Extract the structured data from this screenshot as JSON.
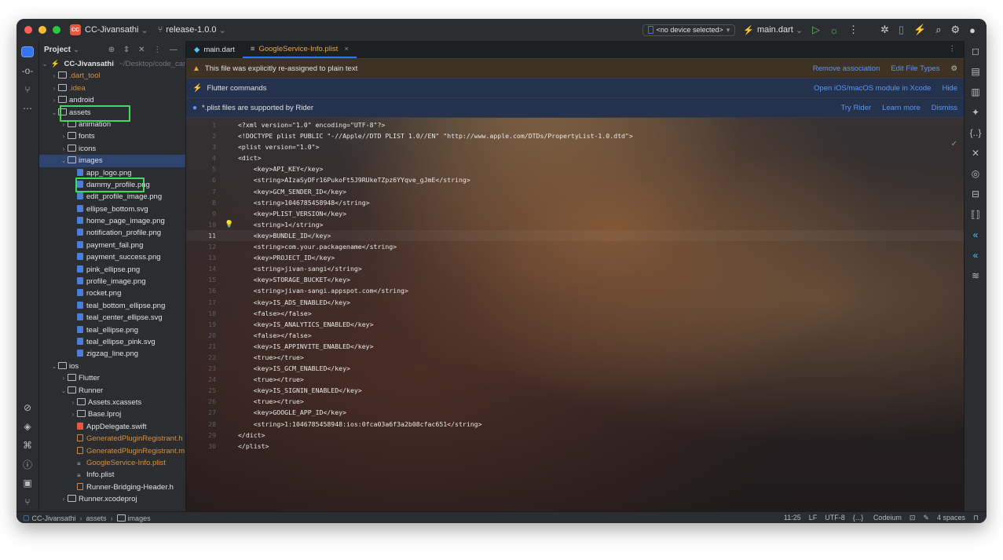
{
  "titlebar": {
    "project_badge": "CC",
    "project": "CC-Jivansathi",
    "branch": "release-1.0.0",
    "device": "<no device selected>",
    "run_config": "main.dart"
  },
  "project_panel": {
    "title": "Project",
    "root_name": "CC-Jivansathi",
    "root_path": "~/Desktop/code_canyo",
    "tree": [
      {
        "label": ".dart_tool",
        "depth": 1,
        "kind": "folder",
        "chev": "›",
        "cls": "excluded"
      },
      {
        "label": ".idea",
        "depth": 1,
        "kind": "folder",
        "chev": "›",
        "cls": "excluded"
      },
      {
        "label": "android",
        "depth": 1,
        "kind": "folder",
        "chev": "›",
        "cls": ""
      },
      {
        "label": "assets",
        "depth": 1,
        "kind": "folder",
        "chev": "⌄",
        "cls": ""
      },
      {
        "label": "animation",
        "depth": 2,
        "kind": "folder",
        "chev": "›",
        "cls": ""
      },
      {
        "label": "fonts",
        "depth": 2,
        "kind": "folder",
        "chev": "›",
        "cls": ""
      },
      {
        "label": "icons",
        "depth": 2,
        "kind": "folder",
        "chev": "›",
        "cls": ""
      },
      {
        "label": "images",
        "depth": 2,
        "kind": "folder",
        "chev": "⌄",
        "cls": "selected"
      },
      {
        "label": "app_logo.png",
        "depth": 3,
        "kind": "img",
        "chev": "",
        "cls": ""
      },
      {
        "label": "dammy_profile.png",
        "depth": 3,
        "kind": "img",
        "chev": "",
        "cls": ""
      },
      {
        "label": "edit_profile_image.png",
        "depth": 3,
        "kind": "img",
        "chev": "",
        "cls": ""
      },
      {
        "label": "ellipse_bottom.svg",
        "depth": 3,
        "kind": "img",
        "chev": "",
        "cls": ""
      },
      {
        "label": "home_page_image.png",
        "depth": 3,
        "kind": "img",
        "chev": "",
        "cls": ""
      },
      {
        "label": "notification_profile.png",
        "depth": 3,
        "kind": "img",
        "chev": "",
        "cls": ""
      },
      {
        "label": "payment_fail.png",
        "depth": 3,
        "kind": "img",
        "chev": "",
        "cls": ""
      },
      {
        "label": "payment_success.png",
        "depth": 3,
        "kind": "img",
        "chev": "",
        "cls": ""
      },
      {
        "label": "pink_ellipse.png",
        "depth": 3,
        "kind": "img",
        "chev": "",
        "cls": ""
      },
      {
        "label": "profile_image.png",
        "depth": 3,
        "kind": "img",
        "chev": "",
        "cls": ""
      },
      {
        "label": "rocket.png",
        "depth": 3,
        "kind": "img",
        "chev": "",
        "cls": ""
      },
      {
        "label": "teal_bottom_ellipse.png",
        "depth": 3,
        "kind": "img",
        "chev": "",
        "cls": ""
      },
      {
        "label": "teal_center_ellipse.svg",
        "depth": 3,
        "kind": "img",
        "chev": "",
        "cls": ""
      },
      {
        "label": "teal_ellipse.png",
        "depth": 3,
        "kind": "img",
        "chev": "",
        "cls": ""
      },
      {
        "label": "teal_ellipse_pink.svg",
        "depth": 3,
        "kind": "img",
        "chev": "",
        "cls": ""
      },
      {
        "label": "zigzag_line.png",
        "depth": 3,
        "kind": "img",
        "chev": "",
        "cls": ""
      },
      {
        "label": "ios",
        "depth": 1,
        "kind": "folder",
        "chev": "⌄",
        "cls": ""
      },
      {
        "label": "Flutter",
        "depth": 2,
        "kind": "folder",
        "chev": "›",
        "cls": ""
      },
      {
        "label": "Runner",
        "depth": 2,
        "kind": "folder",
        "chev": "⌄",
        "cls": ""
      },
      {
        "label": "Assets.xcassets",
        "depth": 3,
        "kind": "folder",
        "chev": "›",
        "cls": ""
      },
      {
        "label": "Base.lproj",
        "depth": 3,
        "kind": "folder",
        "chev": "›",
        "cls": ""
      },
      {
        "label": "AppDelegate.swift",
        "depth": 3,
        "kind": "swift",
        "chev": "",
        "cls": ""
      },
      {
        "label": "GeneratedPluginRegistrant.h",
        "depth": 3,
        "kind": "h",
        "chev": "",
        "cls": "excluded"
      },
      {
        "label": "GeneratedPluginRegistrant.m",
        "depth": 3,
        "kind": "h",
        "chev": "",
        "cls": "excluded"
      },
      {
        "label": "GoogleService-Info.plist",
        "depth": 3,
        "kind": "txt",
        "chev": "",
        "cls": "excluded"
      },
      {
        "label": "Info.plist",
        "depth": 3,
        "kind": "txt",
        "chev": "",
        "cls": ""
      },
      {
        "label": "Runner-Bridging-Header.h",
        "depth": 3,
        "kind": "h",
        "chev": "",
        "cls": ""
      },
      {
        "label": "Runner.xcodeproj",
        "depth": 2,
        "kind": "folder",
        "chev": "›",
        "cls": ""
      }
    ]
  },
  "tabs": [
    {
      "label": "main.dart",
      "active": false
    },
    {
      "label": "GoogleService-Info.plist",
      "active": true
    }
  ],
  "banners": {
    "warning": {
      "text": "This file was explicitly re-assigned to plain text",
      "actions": [
        "Remove association",
        "Edit File Types"
      ]
    },
    "flutter": {
      "text": "Flutter commands",
      "actions": [
        "Open iOS/macOS module in Xcode",
        "Hide"
      ]
    },
    "info": {
      "text": "*.plist files are supported by Rider",
      "actions": [
        "Try Rider",
        "Learn more",
        "Dismiss"
      ]
    }
  },
  "code": {
    "current_line": 11,
    "bulb_line": 10,
    "lines": [
      "<?xml version=\"1.0\" encoding=\"UTF-8\"?>",
      "<!DOCTYPE plist PUBLIC \"-//Apple//DTD PLIST 1.0//EN\" \"http://www.apple.com/DTDs/PropertyList-1.0.dtd\">",
      "<plist version=\"1.0\">",
      "<dict>",
      "    <key>API_KEY</key>",
      "    <string>AIzaSyDFr16PukoFt5J9RUkeTZpz6YYqve_gJmE</string>",
      "    <key>GCM_SENDER_ID</key>",
      "    <string>1046785458948</string>",
      "    <key>PLIST_VERSION</key>",
      "    <string>1</string>",
      "    <key>BUNDLE_ID</key>",
      "    <string>com.your.packagename</string>",
      "    <key>PROJECT_ID</key>",
      "    <string>jivan-sangi</string>",
      "    <key>STORAGE_BUCKET</key>",
      "    <string>jivan-sangi.appspot.com</string>",
      "    <key>IS_ADS_ENABLED</key>",
      "    <false></false>",
      "    <key>IS_ANALYTICS_ENABLED</key>",
      "    <false></false>",
      "    <key>IS_APPINVITE_ENABLED</key>",
      "    <true></true>",
      "    <key>IS_GCM_ENABLED</key>",
      "    <true></true>",
      "    <key>IS_SIGNIN_ENABLED</key>",
      "    <true></true>",
      "    <key>GOOGLE_APP_ID</key>",
      "    <string>1:1046785458948:ios:0fca03a6f3a2b08cfac651</string>",
      "</dict>",
      "</plist>"
    ]
  },
  "statusbar": {
    "breadcrumb": [
      "CC-Jivansathi",
      "assets",
      "images"
    ],
    "position": "11:25",
    "line_sep": "LF",
    "encoding": "UTF-8",
    "plugin": "Codeium",
    "indent": "4 spaces"
  },
  "colors": {
    "accent": "#3574f0",
    "highlight_box": "#3ddc5a",
    "excluded_file": "#d88f3d"
  }
}
